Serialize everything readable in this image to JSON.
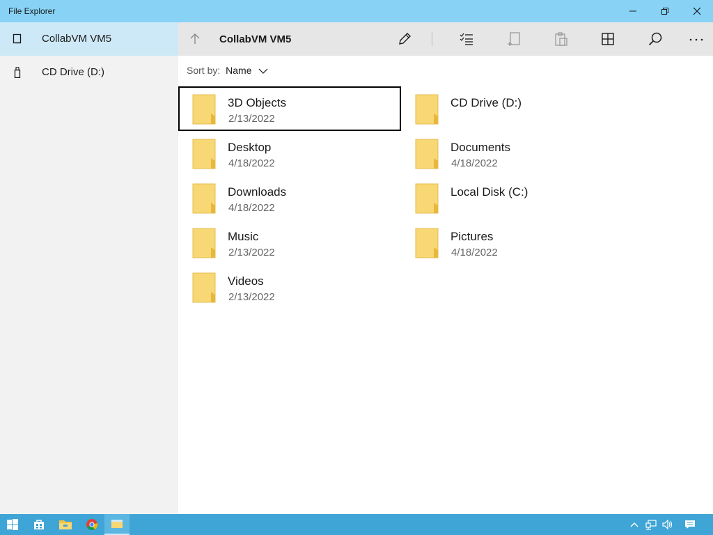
{
  "window": {
    "title": "File Explorer"
  },
  "sidebar": {
    "items": [
      {
        "label": "CollabVM VM5",
        "icon": "computer-icon",
        "selected": true
      },
      {
        "label": "CD Drive (D:)",
        "icon": "usb-drive-icon",
        "selected": false
      }
    ]
  },
  "toolbar": {
    "path": "CollabVM VM5",
    "buttons": [
      "up-arrow-icon",
      "rename-icon",
      "select-icon",
      "new-folder-icon",
      "paste-icon",
      "view-icon",
      "search-icon",
      "more-icon"
    ]
  },
  "sort": {
    "label": "Sort by:",
    "value": "Name"
  },
  "items": [
    {
      "name": "3D Objects",
      "date": "2/13/2022"
    },
    {
      "name": "CD Drive (D:)",
      "date": ""
    },
    {
      "name": "Desktop",
      "date": "4/18/2022"
    },
    {
      "name": "Documents",
      "date": "4/18/2022"
    },
    {
      "name": "Downloads",
      "date": "4/18/2022"
    },
    {
      "name": "Local Disk (C:)",
      "date": ""
    },
    {
      "name": "Music",
      "date": "2/13/2022"
    },
    {
      "name": "Pictures",
      "date": "4/18/2022"
    },
    {
      "name": "Videos",
      "date": "2/13/2022"
    }
  ],
  "taskbar": {
    "icons": [
      "start-icon",
      "store-icon",
      "file-explorer-icon",
      "chrome-icon",
      "files-app-icon"
    ],
    "tray": [
      "chevron-up-icon",
      "network-icon",
      "volume-icon",
      "notification-icon"
    ]
  },
  "colors": {
    "titlebar": "#87d2f5",
    "sidebar_selected": "#cde8f7",
    "taskbar": "#3fa5d6",
    "folder": "#f8d775"
  }
}
